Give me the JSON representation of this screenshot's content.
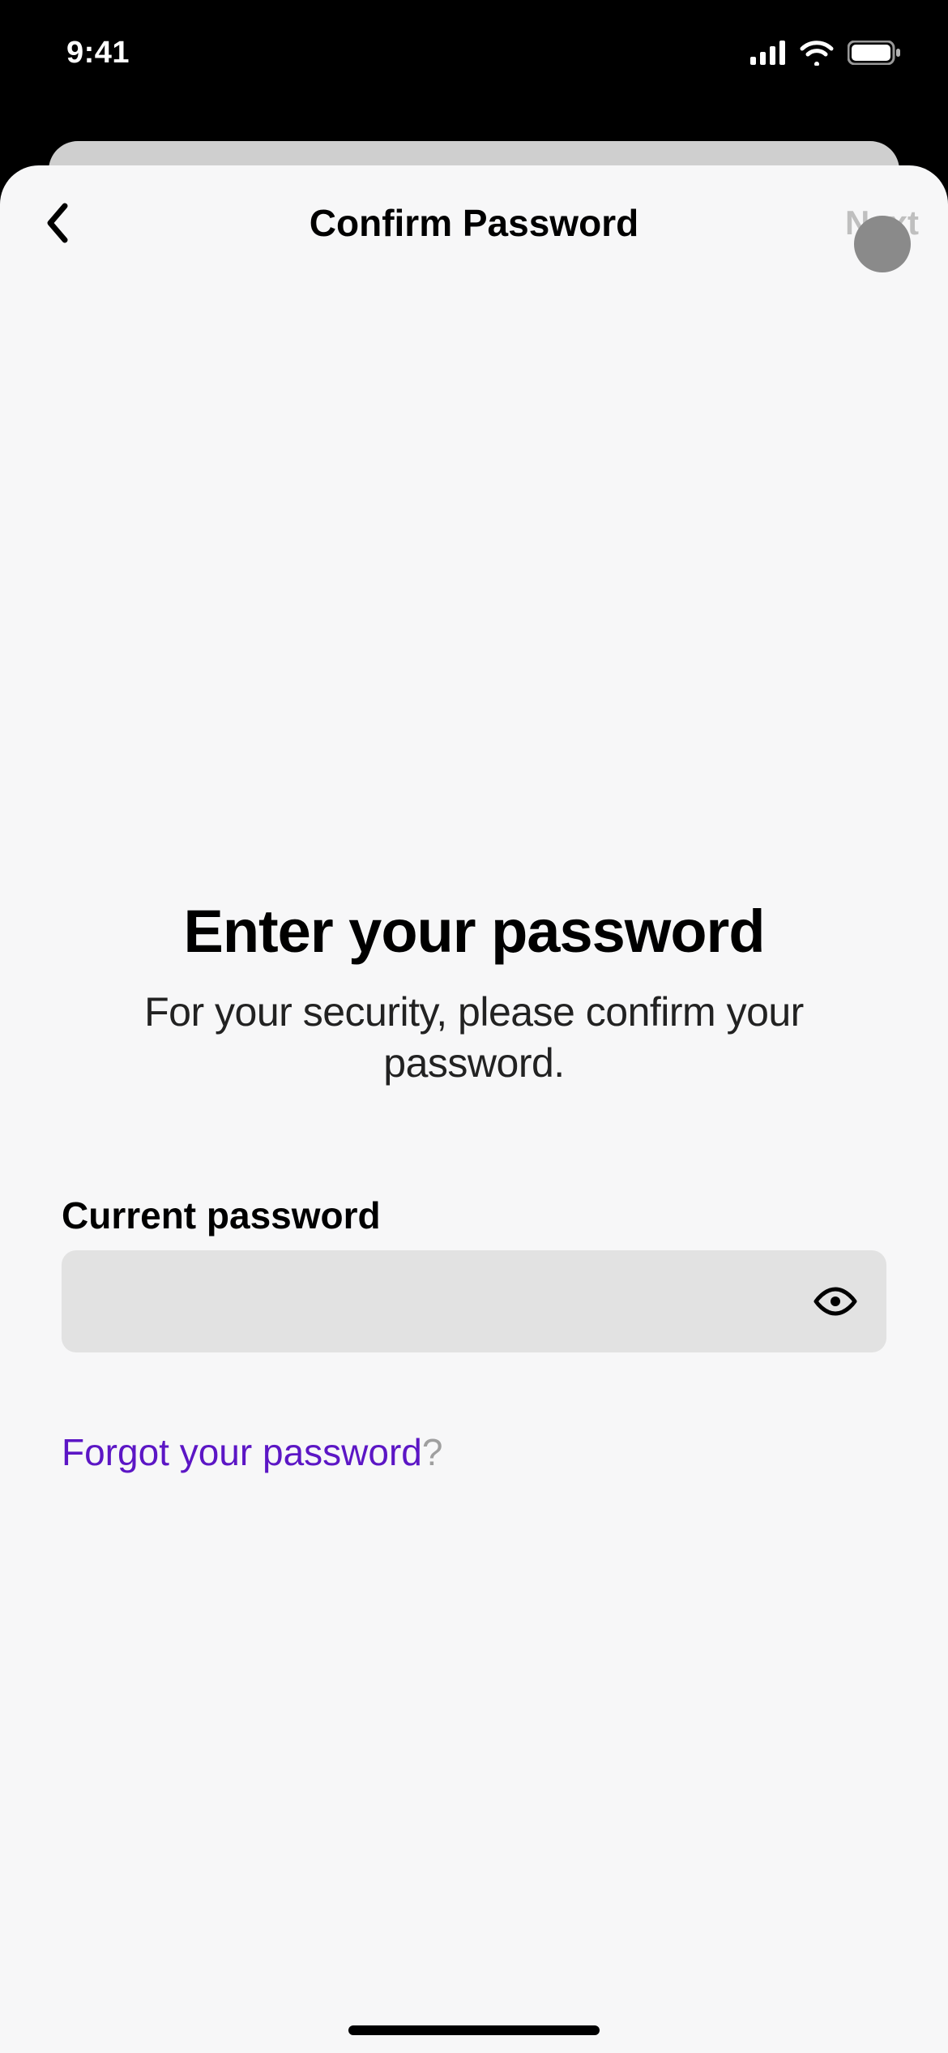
{
  "statusbar": {
    "time": "9:41"
  },
  "nav": {
    "title": "Confirm Password",
    "next_label": "Next"
  },
  "main": {
    "heading": "Enter your password",
    "subheading": "For your security, please confirm your password."
  },
  "field": {
    "label": "Current password",
    "value": ""
  },
  "forgot": {
    "text": "Forgot your password",
    "q": "?"
  }
}
